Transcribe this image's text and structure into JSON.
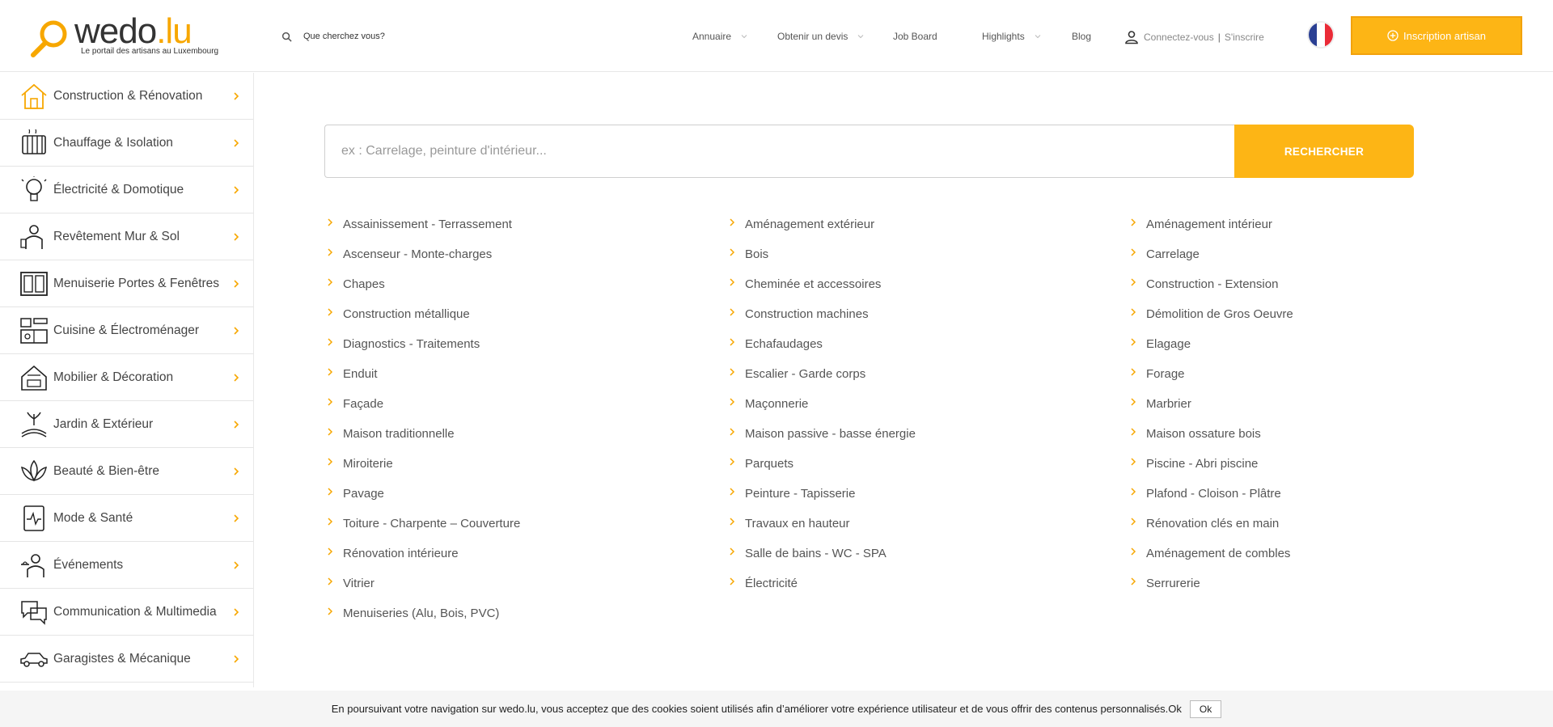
{
  "colors": {
    "accent": "#fdb515",
    "accent_border": "#f2a20d",
    "text": "#555555",
    "flag_blue": "#2a3f93",
    "flag_white": "#ffffff",
    "flag_red": "#ea2b37"
  },
  "header": {
    "logo": {
      "main": "wedo",
      "dot_lu": ".lu",
      "tagline": "Le portail des artisans au Luxembourg"
    },
    "search_placeholder": "Que cherchez vous?",
    "nav": {
      "annuaire": "Annuaire",
      "devis": "Obtenir un devis",
      "job_board": "Job Board",
      "highlights": "Highlights",
      "blog": "Blog"
    },
    "login": {
      "connect": "Connectez-vous",
      "separator": "|",
      "register": "S'inscrire"
    },
    "language_flag": "fr-flag-icon",
    "cta": "Inscription artisan"
  },
  "sidebar": {
    "items": [
      {
        "label": "Construction & Rénovation",
        "icon": "house-icon"
      },
      {
        "label": "Chauffage & Isolation",
        "icon": "radiator-icon"
      },
      {
        "label": "Électricité & Domotique",
        "icon": "lightbulb-icon"
      },
      {
        "label": "Revêtement Mur & Sol",
        "icon": "painter-icon"
      },
      {
        "label": "Menuiserie Portes & Fenêtres",
        "icon": "window-icon"
      },
      {
        "label": "Cuisine & Électroménager",
        "icon": "kitchen-icon"
      },
      {
        "label": "Mobilier & Décoration",
        "icon": "furniture-icon"
      },
      {
        "label": "Jardin & Extérieur",
        "icon": "garden-icon"
      },
      {
        "label": "Beauté & Bien-être",
        "icon": "lotus-icon"
      },
      {
        "label": "Mode & Santé",
        "icon": "health-icon"
      },
      {
        "label": "Événements",
        "icon": "waiter-icon"
      },
      {
        "label": "Communication & Multimedia",
        "icon": "chat-icon"
      },
      {
        "label": "Garagistes & Mécanique",
        "icon": "car-icon"
      }
    ]
  },
  "main_search": {
    "placeholder": "ex : Carrelage, peinture d'intérieur...",
    "button": "RECHERCHER"
  },
  "categories": {
    "col0": [
      "Assainissement - Terrassement",
      "Ascenseur - Monte-charges",
      "Chapes",
      "Construction métallique",
      "Diagnostics - Traitements",
      "Enduit",
      "Façade",
      "Maison traditionnelle",
      "Miroiterie",
      "Pavage",
      "Toiture - Charpente – Couverture",
      "Rénovation intérieure",
      "Vitrier",
      "Menuiseries (Alu, Bois, PVC)"
    ],
    "col1": [
      "Aménagement extérieur",
      "Bois",
      "Cheminée et accessoires",
      "Construction machines",
      "Echafaudages",
      "Escalier - Garde corps",
      "Maçonnerie",
      "Maison passive - basse énergie",
      "Parquets",
      "Peinture - Tapisserie",
      "Travaux en hauteur",
      "Salle de bains - WC - SPA",
      "Électricité"
    ],
    "col2": [
      "Aménagement intérieur",
      "Carrelage",
      "Construction - Extension",
      "Démolition de Gros Oeuvre",
      "Elagage",
      "Forage",
      "Marbrier",
      "Maison ossature bois",
      "Piscine - Abri piscine",
      "Plafond - Cloison - Plâtre",
      "Rénovation clés en main",
      "Aménagement de combles",
      "Serrurerie"
    ]
  },
  "cookie": {
    "text": "En poursuivant votre navigation sur wedo.lu, vous acceptez que des cookies soient utilisés afin d’améliorer votre expérience utilisateur et de vous offrir des contenus personnalisés.Ok",
    "button": "Ok"
  }
}
